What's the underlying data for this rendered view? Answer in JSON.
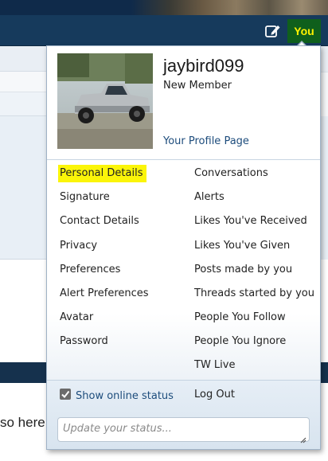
{
  "nav": {
    "you_label": "You"
  },
  "background": {
    "partial_text": "so here"
  },
  "user": {
    "name": "jaybird099",
    "title": "New Member",
    "profile_link": "Your Profile Page"
  },
  "menu": {
    "left_links": [
      "Personal Details",
      "Signature",
      "Contact Details",
      "Privacy",
      "Preferences",
      "Alert Preferences",
      "Avatar",
      "Password"
    ],
    "right_links": [
      "Conversations",
      "Alerts",
      "Likes You've Received",
      "Likes You've Given",
      "Posts made by you",
      "Threads started by you",
      "People You Follow",
      "People You Ignore",
      "TW Live"
    ]
  },
  "footer": {
    "show_online_label": "Show online status",
    "show_online_checked": true,
    "logout_label": "Log Out",
    "status_placeholder": "Update your status..."
  },
  "colors": {
    "navbar": "#163a5c",
    "you_button": "#0f5f1c",
    "you_text": "#fff200",
    "highlight": "#fbf509",
    "link": "#1d4c7c"
  }
}
